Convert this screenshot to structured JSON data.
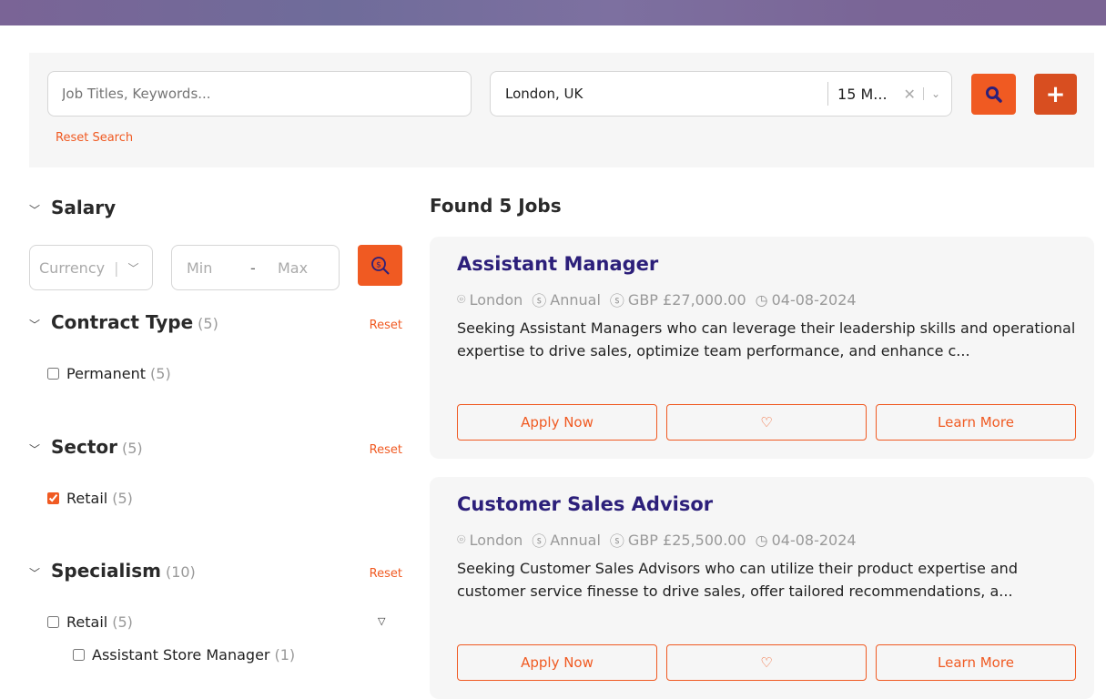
{
  "search": {
    "keywords_placeholder": "Job Titles, Keywords...",
    "location": "London, UK",
    "radius": "15 M...",
    "reset": "Reset Search",
    "accent": "#f05a22"
  },
  "filters": {
    "salary": {
      "title": "Salary",
      "currency_placeholder": "Currency",
      "min_placeholder": "Min",
      "dash": "-",
      "max_placeholder": "Max"
    },
    "contract": {
      "title": "Contract Type",
      "count": "(5)",
      "reset": "Reset",
      "options": [
        {
          "label": "Permanent",
          "count": "(5)",
          "checked": false
        }
      ]
    },
    "sector": {
      "title": "Sector",
      "count": "(5)",
      "reset": "Reset",
      "options": [
        {
          "label": "Retail",
          "count": "(5)",
          "checked": true
        }
      ]
    },
    "specialism": {
      "title": "Specialism",
      "count": "(10)",
      "reset": "Reset",
      "options": [
        {
          "label": "Retail",
          "count": "(5)",
          "checked": false
        },
        {
          "label": "Assistant Store Manager",
          "count": "(1)",
          "checked": false
        }
      ]
    }
  },
  "results": {
    "heading": "Found 5 Jobs",
    "jobs": [
      {
        "title": "Assistant Manager",
        "location": "London",
        "type": "Annual",
        "salary": "GBP £27,000.00",
        "date": "04-08-2024",
        "description": "Seeking Assistant Managers who can leverage their leadership skills and operational expertise to drive sales, optimize team performance, and enhance c...",
        "apply": "Apply Now",
        "learn": "Learn More"
      },
      {
        "title": "Customer Sales Advisor",
        "location": "London",
        "type": "Annual",
        "salary": "GBP £25,500.00",
        "date": "04-08-2024",
        "description": "Seeking Customer Sales Advisors who can utilize their product expertise and customer service finesse to drive sales, offer tailored recommendations, a...",
        "apply": "Apply Now",
        "learn": "Learn More"
      }
    ]
  }
}
